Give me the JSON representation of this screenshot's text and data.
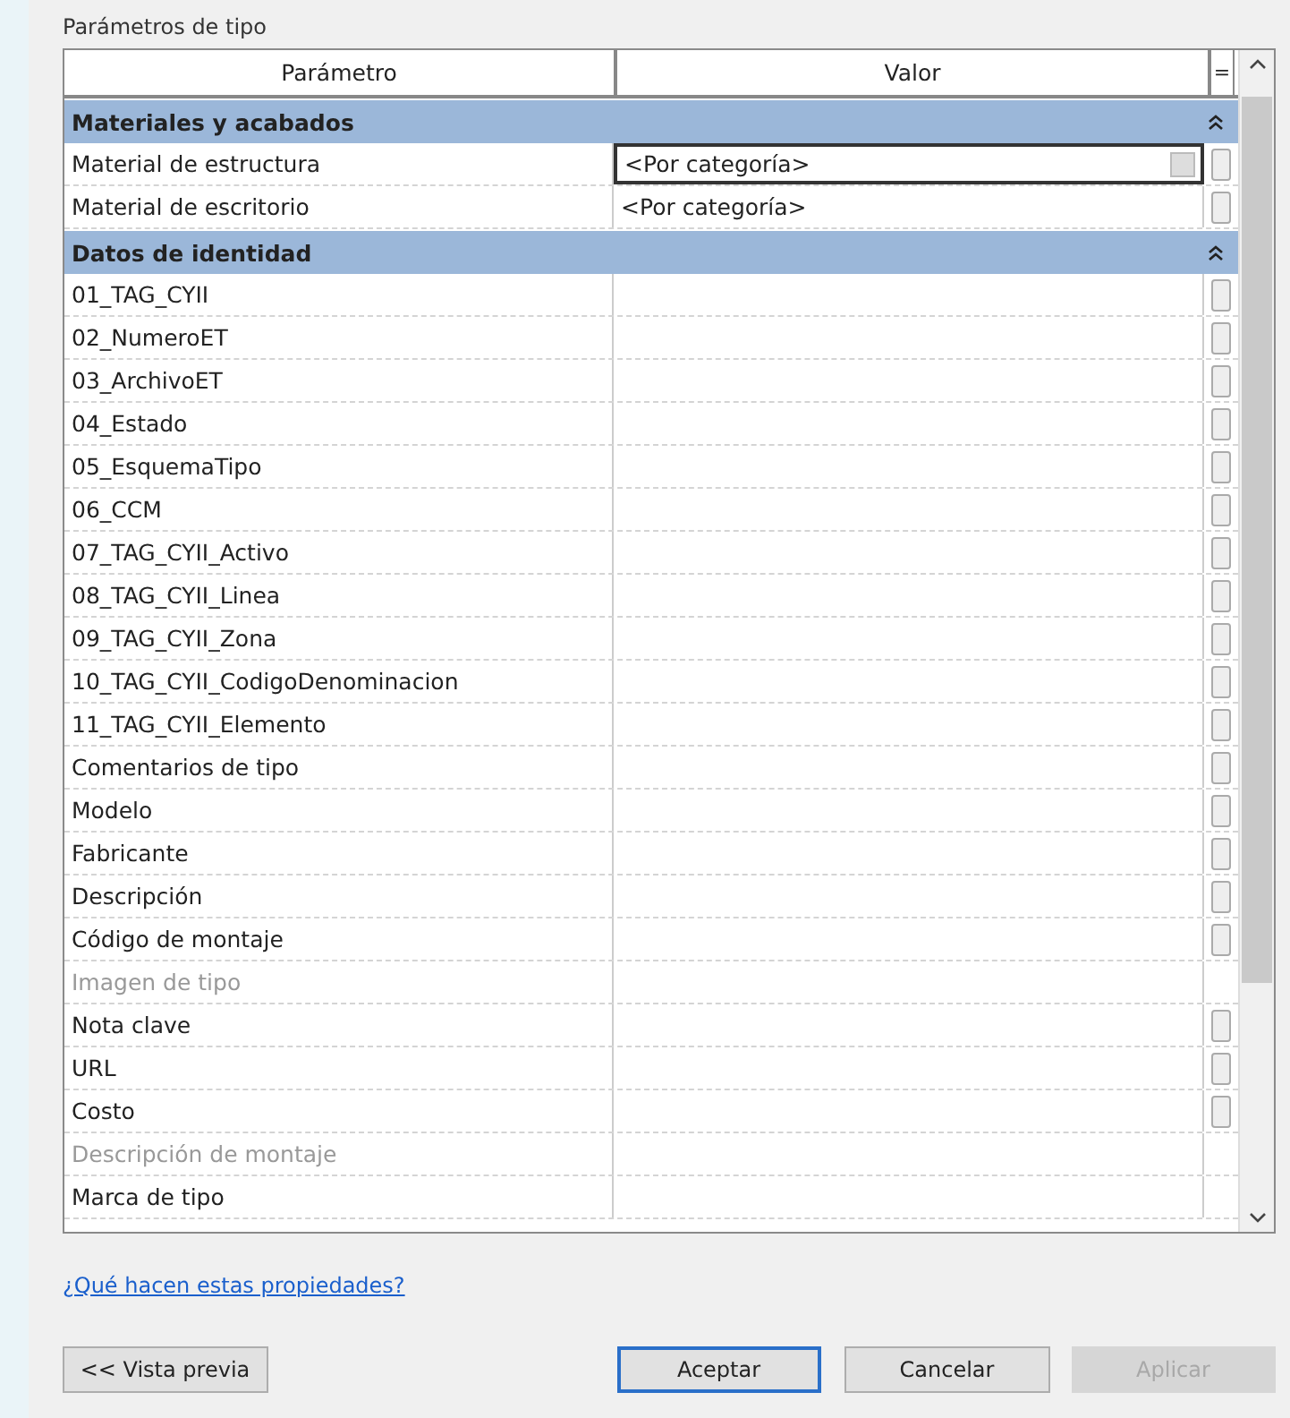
{
  "title": "Parámetros de tipo",
  "columns": [
    "Parámetro",
    "Valor",
    "="
  ],
  "rows": [
    {
      "kind": "group",
      "name": "Materiales y acabados",
      "expanded": true
    },
    {
      "kind": "param",
      "name": "Material de estructura",
      "value": "<Por categoría>",
      "selected": true,
      "disabled": false,
      "associate": true
    },
    {
      "kind": "param",
      "name": "Material de escritorio",
      "value": "<Por categoría>",
      "selected": false,
      "disabled": false,
      "associate": true
    },
    {
      "kind": "group",
      "name": "Datos de identidad",
      "expanded": true
    },
    {
      "kind": "param",
      "name": "01_TAG_CYII",
      "selected": false,
      "disabled": false,
      "associate": true
    },
    {
      "kind": "param",
      "name": "02_NumeroET",
      "selected": false,
      "disabled": false,
      "associate": true
    },
    {
      "kind": "param",
      "name": "03_ArchivoET",
      "selected": false,
      "disabled": false,
      "associate": true
    },
    {
      "kind": "param",
      "name": "04_Estado",
      "selected": false,
      "disabled": false,
      "associate": true
    },
    {
      "kind": "param",
      "name": "05_EsquemaTipo",
      "selected": false,
      "disabled": false,
      "associate": true
    },
    {
      "kind": "param",
      "name": "06_CCM",
      "selected": false,
      "disabled": false,
      "associate": true
    },
    {
      "kind": "param",
      "name": "07_TAG_CYII_Activo",
      "selected": false,
      "disabled": false,
      "associate": true
    },
    {
      "kind": "param",
      "name": "08_TAG_CYII_Linea",
      "selected": false,
      "disabled": false,
      "associate": true
    },
    {
      "kind": "param",
      "name": "09_TAG_CYII_Zona",
      "selected": false,
      "disabled": false,
      "associate": true
    },
    {
      "kind": "param",
      "name": "10_TAG_CYII_CodigoDenominacion",
      "selected": false,
      "disabled": false,
      "associate": true
    },
    {
      "kind": "param",
      "name": "11_TAG_CYII_Elemento",
      "selected": false,
      "disabled": false,
      "associate": true
    },
    {
      "kind": "param",
      "name": "Comentarios de tipo",
      "selected": false,
      "disabled": false,
      "associate": true
    },
    {
      "kind": "param",
      "name": "Modelo",
      "selected": false,
      "disabled": false,
      "associate": true
    },
    {
      "kind": "param",
      "name": "Fabricante",
      "selected": false,
      "disabled": false,
      "associate": true
    },
    {
      "kind": "param",
      "name": "Descripción",
      "selected": false,
      "disabled": false,
      "associate": true
    },
    {
      "kind": "param",
      "name": "Código de montaje",
      "selected": false,
      "disabled": false,
      "associate": true
    },
    {
      "kind": "param",
      "name": "Imagen de tipo",
      "selected": false,
      "disabled": true,
      "associate": false
    },
    {
      "kind": "param",
      "name": "Nota clave",
      "selected": false,
      "disabled": false,
      "associate": true
    },
    {
      "kind": "param",
      "name": "URL",
      "selected": false,
      "disabled": false,
      "associate": true
    },
    {
      "kind": "param",
      "name": "Costo",
      "selected": false,
      "disabled": false,
      "associate": true
    },
    {
      "kind": "param",
      "name": "Descripción de montaje",
      "selected": false,
      "disabled": true,
      "associate": false
    },
    {
      "kind": "param",
      "name": "Marca de tipo",
      "selected": false,
      "disabled": false,
      "associate": false
    }
  ],
  "help_link": "¿Qué hacen estas propiedades?",
  "buttons": [
    {
      "label": "<< Vista previa",
      "default": false,
      "disabled": false
    },
    {
      "label": "Aceptar",
      "default": true,
      "disabled": false
    },
    {
      "label": "Cancelar",
      "default": false,
      "disabled": false
    },
    {
      "label": "Aplicar",
      "default": false,
      "disabled": true
    }
  ]
}
